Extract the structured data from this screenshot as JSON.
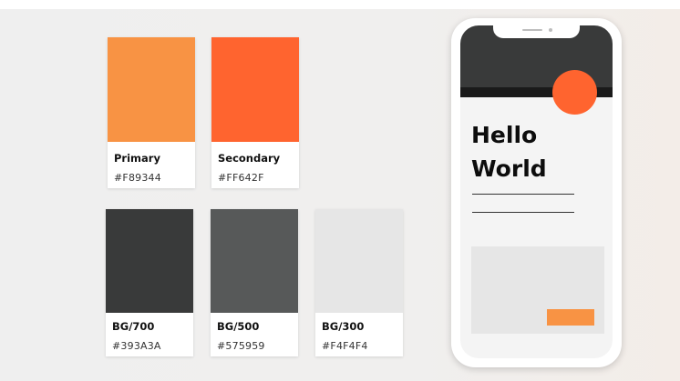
{
  "swatches": [
    {
      "name": "Primary",
      "hex": "#F89344",
      "color": "#F89344"
    },
    {
      "name": "Secondary",
      "hex": "#FF642F",
      "color": "#FF642F"
    },
    {
      "name": "BG/700",
      "hex": "#393A3A",
      "color": "#393A3A"
    },
    {
      "name": "BG/500",
      "hex": "#575959",
      "color": "#575959"
    },
    {
      "name": "BG/300",
      "hex": "#F4F4F4",
      "color": "#E6E6E6"
    }
  ],
  "phone": {
    "heading_line1": "Hello",
    "heading_line2": "World"
  }
}
